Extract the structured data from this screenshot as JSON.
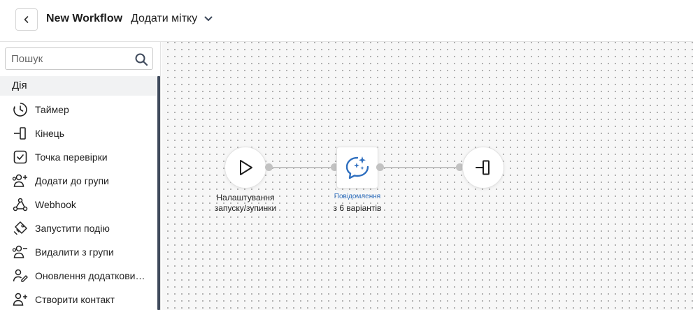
{
  "header": {
    "back_icon": "chevron-left-icon",
    "title": "New Workflow",
    "tag_label": "Додати мітку",
    "tag_icon": "chevron-down-icon"
  },
  "sidebar": {
    "search_placeholder": "Пошук",
    "section_title": "Дія",
    "items": [
      {
        "label": "Таймер",
        "icon": "timer-icon"
      },
      {
        "label": "Кінець",
        "icon": "end-icon"
      },
      {
        "label": "Точка перевірки",
        "icon": "checkpoint-icon"
      },
      {
        "label": "Додати до групи",
        "icon": "add-to-group-icon"
      },
      {
        "label": "Webhook",
        "icon": "webhook-icon"
      },
      {
        "label": "Запустити подію",
        "icon": "trigger-event-icon"
      },
      {
        "label": "Видалити з групи",
        "icon": "remove-from-group-icon"
      },
      {
        "label": "Оновлення додаткови…",
        "icon": "update-contact-icon"
      },
      {
        "label": "Створити контакт",
        "icon": "create-contact-icon"
      }
    ]
  },
  "canvas": {
    "nodes": {
      "start": {
        "label_line1": "Налаштування",
        "label_line2": "запуску/зупинки",
        "icon": "play-icon"
      },
      "message": {
        "sublabel": "Повідомлення",
        "label": "з 6 варіантів",
        "icon": "ai-message-icon"
      },
      "end": {
        "icon": "end-icon"
      }
    }
  },
  "colors": {
    "accent": "#2f6fbf",
    "sidebar_scrollbar": "#3f4a5c",
    "connector": "#c2c2c2"
  }
}
